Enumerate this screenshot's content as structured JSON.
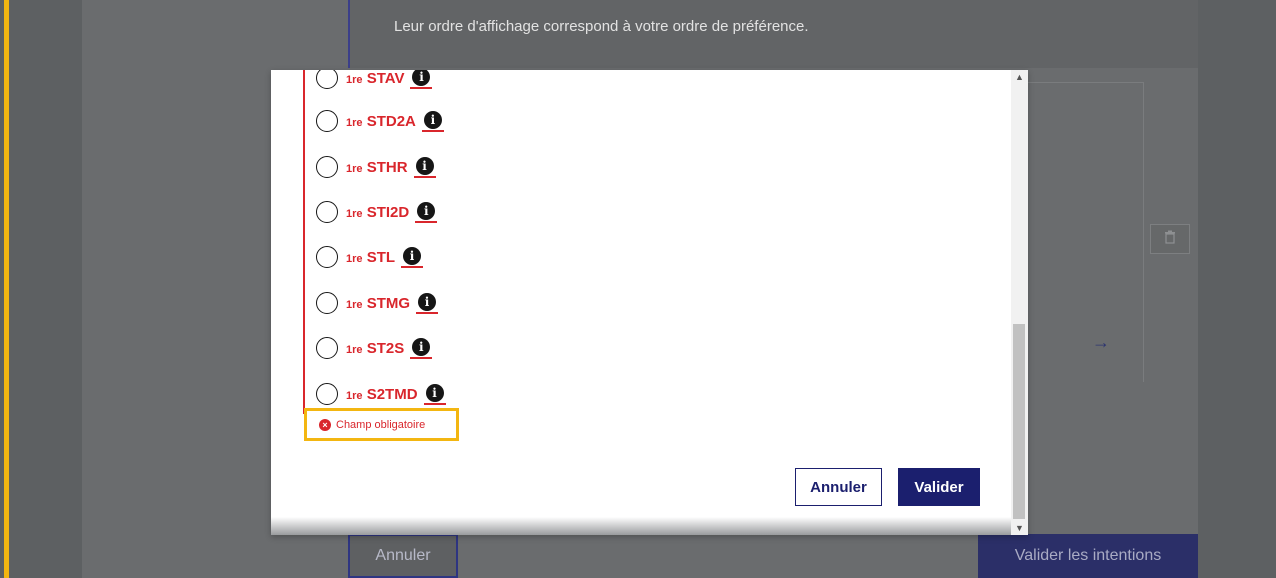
{
  "background": {
    "note_text": "Leur ordre d'affichage correspond à votre ordre de préférence.",
    "cancel_label": "Annuler",
    "validate_label": "Valider les intentions",
    "trash_icon": "trash-icon",
    "arrow_icon": "arrow-right-icon"
  },
  "modal": {
    "options": [
      {
        "prefix": "1re",
        "label": "STAV"
      },
      {
        "prefix": "1re",
        "label": "STD2A"
      },
      {
        "prefix": "1re",
        "label": "STHR"
      },
      {
        "prefix": "1re",
        "label": "STI2D"
      },
      {
        "prefix": "1re",
        "label": "STL"
      },
      {
        "prefix": "1re",
        "label": "STMG"
      },
      {
        "prefix": "1re",
        "label": "ST2S"
      },
      {
        "prefix": "1re",
        "label": "S2TMD"
      }
    ],
    "info_glyph": "i",
    "error_text": "Champ obligatoire",
    "error_glyph": "×",
    "cancel_label": "Annuler",
    "validate_label": "Valider"
  },
  "colors": {
    "error_red": "#d9262c",
    "focus_yellow": "#f3b611",
    "primary_blue": "#1b1f6e"
  }
}
